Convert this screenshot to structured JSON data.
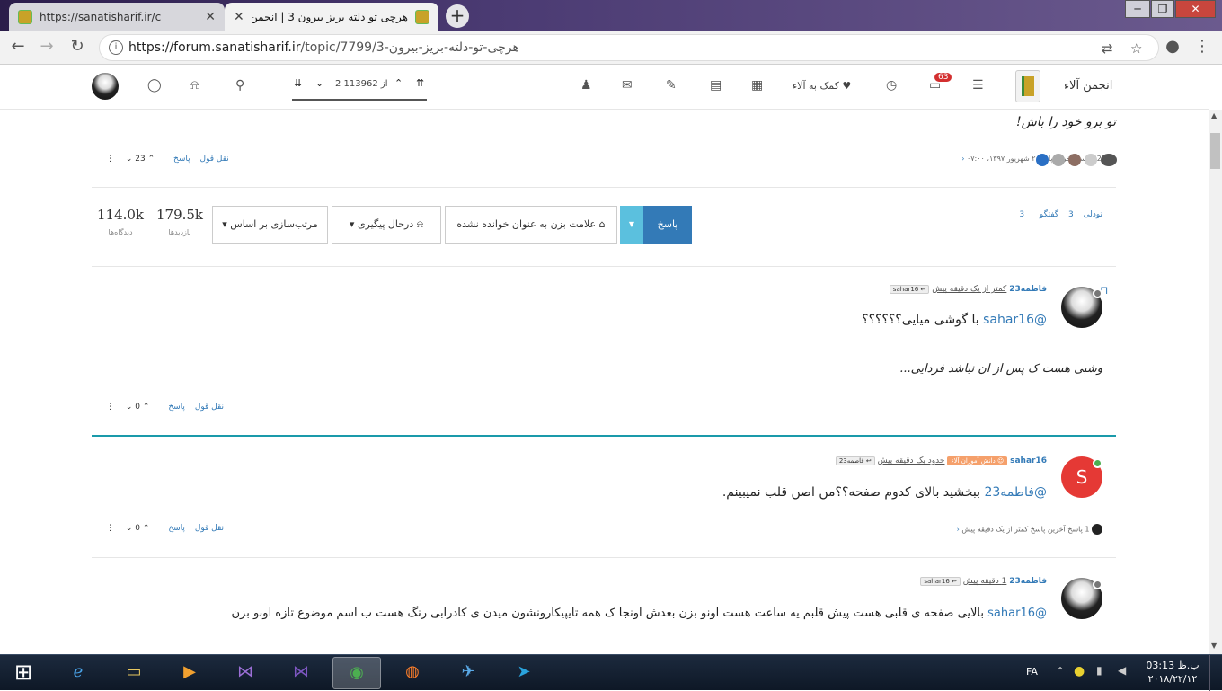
{
  "browser": {
    "tabs": [
      {
        "title": "https://sanatisharif.ir/c",
        "active": false
      },
      {
        "title": "هرچی تو دلته بریز بیرون 3 | انجمن دانش آ",
        "active": true
      }
    ],
    "new_tab": "+",
    "url_host": "https://forum.sanatisharif.ir",
    "url_path": "/topic/7799/3-هرچی-تو-دلته-بریز-بیرون",
    "window_controls": {
      "min": "─",
      "max": "❐",
      "close": "✕"
    }
  },
  "forum_header": {
    "brand": "انجمن آلاء",
    "notifications_count": "63",
    "help_link": "کمک به آلاء",
    "pagination": "2 از 113962"
  },
  "top_post": {
    "text": "تو برو خود را باش!",
    "replies_summary": "229 پاسخ  آخرین پاسخ ۲ شهریور ۱۳۹۷، ۰۷:۰۰",
    "actions": {
      "reply": "پاسخ",
      "quote": "نقل قول",
      "votes": "23"
    }
  },
  "topic_bar": {
    "tag1": "تودلی",
    "tag1_count": "3",
    "tag2": "گفتگو",
    "tag2_count": "3",
    "reply_button": "پاسخ",
    "mark_unread": "علامت بزن به عنوان خوانده نشده",
    "watching": "درحال پیگیری",
    "sort": "مرتب‌سازی بر اساس",
    "views": {
      "value": "179.5k",
      "label": "بازدیدها"
    },
    "posts": {
      "value": "114.0k",
      "label": "دیدگاه‌ها"
    }
  },
  "posts": [
    {
      "author": "فاطمه23",
      "time": "کمتر از یک دقیقه پیش",
      "reply_to": "sahar16",
      "mention": "@sahar16",
      "text": "با گوشی میایی؟؟؟؟؟؟",
      "signature": "وشبی هست ک پس از ان نباشد فردایی...",
      "actions": {
        "reply": "پاسخ",
        "quote": "نقل قول",
        "votes": "0"
      }
    },
    {
      "author": "sahar16",
      "badge": "دانش آموزان آلاء",
      "time": "حدود یک دقیقه پیش",
      "reply_to": "فاطمه23",
      "avatar_letter": "S",
      "mention": "@فاطمه23",
      "text": "ببخشید بالای کدوم صفحه؟؟من اصن قلب نمیبینم.",
      "replies_summary": "1 پاسخ  آخرین پاسخ کمتر از یک دقیقه پیش",
      "actions": {
        "reply": "پاسخ",
        "quote": "نقل قول",
        "votes": "0"
      }
    },
    {
      "author": "فاطمه23",
      "time": "1 دقیقه پیش",
      "reply_to": "sahar16",
      "mention": "@sahar16",
      "text": "بالایی صفحه ی قلبی هست پیش قلبم یه ساعت هست اونو بزن بعدش اونجا ک همه تایپیکارونشون میدن ی کادرابی رنگ هست ب اسم موضوع تازه اونو بزن"
    }
  ],
  "taskbar": {
    "lang": "FA",
    "time": "03:13 ب.ظ",
    "date": "۲۰۱۸/۲۲/۱۲"
  },
  "colors": {
    "accent": "#337ab7",
    "reply_button": "#337ab7",
    "online": "#4caf50",
    "avatar_s": "#e53935",
    "divider_active": "#1a9aaa"
  }
}
